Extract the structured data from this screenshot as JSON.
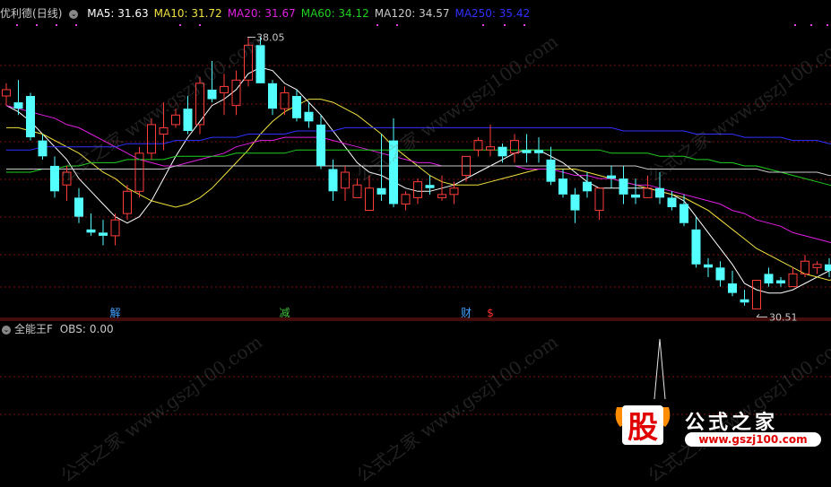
{
  "stock_name": "优利德",
  "period": "(日线)",
  "ma_legend": [
    {
      "label": "MA5",
      "value": "31.63",
      "color": "#ffffff"
    },
    {
      "label": "MA10",
      "value": "31.72",
      "color": "#f0e040"
    },
    {
      "label": "MA20",
      "value": "31.67",
      "color": "#e020e0"
    },
    {
      "label": "MA60",
      "value": "34.12",
      "color": "#20d020"
    },
    {
      "label": "MA120",
      "value": "34.57",
      "color": "#c8c8c8"
    },
    {
      "label": "MA250",
      "value": "35.42",
      "color": "#3030ff"
    }
  ],
  "indicator": {
    "name": "全能王F",
    "series_label": "OBS:",
    "series_value": "0.00"
  },
  "high_label": "38.05",
  "low_label": "30.51",
  "event_markers": [
    {
      "text": "解",
      "color": "#40a0ff"
    },
    {
      "text": "减",
      "color": "#40c040"
    },
    {
      "text": "财",
      "color": "#40a0ff"
    },
    {
      "text": "$",
      "color": "#ff3030"
    }
  ],
  "watermark": {
    "text": "公式之家",
    "url": "www.gszj100.com",
    "diag_text": "公式之家 www.gszj100.com",
    "logo_char": "股"
  },
  "colors": {
    "up": "#ff3c3c",
    "down": "#54ffff",
    "bg": "#000000",
    "grid": "#7a1010"
  },
  "chart_data": {
    "type": "candlestick",
    "title": "优利德 (日线)",
    "price_range": [
      29.2,
      38.6
    ],
    "candles": [
      [
        36.2,
        36.6,
        35.9,
        36.4
      ],
      [
        36.0,
        36.7,
        35.6,
        35.8
      ],
      [
        36.2,
        36.3,
        34.8,
        34.9
      ],
      [
        34.8,
        35.0,
        34.2,
        34.3
      ],
      [
        34.0,
        34.3,
        33.0,
        33.2
      ],
      [
        33.4,
        34.0,
        32.9,
        33.8
      ],
      [
        33.0,
        33.3,
        32.2,
        32.4
      ],
      [
        32.0,
        32.5,
        31.8,
        31.9
      ],
      [
        31.9,
        32.3,
        31.5,
        31.8
      ],
      [
        31.8,
        32.5,
        31.5,
        32.3
      ],
      [
        32.5,
        33.4,
        32.3,
        33.2
      ],
      [
        33.2,
        34.6,
        33.0,
        34.4
      ],
      [
        34.4,
        35.5,
        34.2,
        35.3
      ],
      [
        35.0,
        36.0,
        34.5,
        35.2
      ],
      [
        35.3,
        35.8,
        35.2,
        35.6
      ],
      [
        35.8,
        36.2,
        35.0,
        35.1
      ],
      [
        35.3,
        36.8,
        35.0,
        36.6
      ],
      [
        36.4,
        37.3,
        36.0,
        36.1
      ],
      [
        36.3,
        36.9,
        35.6,
        36.5
      ],
      [
        35.9,
        37.0,
        35.6,
        36.7
      ],
      [
        36.7,
        38.05,
        36.5,
        37.8
      ],
      [
        37.8,
        38.05,
        36.6,
        36.6
      ],
      [
        36.6,
        36.7,
        35.6,
        35.8
      ],
      [
        35.8,
        36.5,
        35.6,
        36.3
      ],
      [
        36.2,
        36.4,
        35.4,
        35.5
      ],
      [
        35.7,
        36.0,
        35.2,
        35.4
      ],
      [
        35.3,
        35.6,
        33.9,
        34.0
      ],
      [
        33.9,
        34.2,
        32.9,
        33.2
      ],
      [
        33.3,
        34.0,
        32.9,
        33.8
      ],
      [
        33.0,
        33.6,
        33.0,
        33.4
      ],
      [
        32.6,
        33.7,
        32.6,
        33.3
      ],
      [
        33.3,
        35.0,
        32.9,
        33.1
      ],
      [
        34.8,
        35.5,
        32.7,
        32.8
      ],
      [
        32.8,
        33.2,
        32.6,
        33.1
      ],
      [
        33.0,
        33.6,
        32.8,
        33.5
      ],
      [
        33.4,
        33.7,
        33.1,
        33.3
      ],
      [
        33.0,
        33.7,
        32.9,
        33.1
      ],
      [
        33.1,
        33.5,
        32.8,
        33.3
      ],
      [
        33.7,
        34.3,
        33.5,
        34.3
      ],
      [
        34.5,
        34.9,
        34.3,
        34.8
      ],
      [
        34.5,
        35.3,
        34.3,
        34.6
      ],
      [
        34.6,
        34.7,
        34.1,
        34.3
      ],
      [
        34.4,
        35.0,
        34.1,
        34.8
      ],
      [
        34.5,
        35.0,
        34.1,
        34.4
      ],
      [
        34.5,
        34.9,
        34.1,
        34.4
      ],
      [
        34.2,
        34.6,
        33.4,
        33.5
      ],
      [
        33.6,
        33.9,
        33.0,
        33.1
      ],
      [
        33.1,
        33.3,
        32.2,
        32.6
      ],
      [
        33.5,
        33.8,
        33.0,
        33.2
      ],
      [
        32.6,
        33.3,
        32.3,
        33.3
      ],
      [
        33.7,
        34.0,
        33.3,
        33.6
      ],
      [
        33.6,
        34.0,
        32.8,
        33.1
      ],
      [
        33.1,
        33.6,
        32.8,
        33.0
      ],
      [
        33.0,
        33.7,
        33.0,
        33.3
      ],
      [
        33.3,
        33.8,
        32.8,
        33.0
      ],
      [
        33.0,
        33.2,
        32.6,
        32.7
      ],
      [
        32.8,
        33.1,
        32.1,
        32.2
      ],
      [
        32.0,
        32.4,
        30.8,
        30.9
      ],
      [
        30.9,
        31.1,
        30.5,
        30.8
      ],
      [
        30.8,
        31.0,
        30.2,
        30.4
      ],
      [
        30.3,
        30.7,
        29.9,
        30.0
      ],
      [
        29.8,
        30.1,
        29.6,
        29.7
      ],
      [
        29.5,
        30.4,
        29.5,
        30.4
      ],
      [
        30.6,
        30.8,
        30.2,
        30.3
      ],
      [
        30.4,
        30.5,
        30.2,
        30.3
      ],
      [
        30.2,
        30.8,
        30.2,
        30.6
      ],
      [
        30.6,
        31.2,
        30.5,
        31.0
      ],
      [
        30.8,
        31.0,
        30.6,
        30.9
      ],
      [
        30.9,
        31.1,
        30.5,
        30.7
      ],
      [
        30.7,
        31.0,
        30.3,
        30.5
      ]
    ],
    "ma_series": {
      "MA5": [
        35.9,
        35.7,
        35.4,
        35.0,
        34.6,
        34.2,
        33.6,
        33.2,
        32.8,
        32.4,
        32.2,
        32.4,
        32.9,
        33.6,
        34.3,
        34.9,
        35.4,
        35.9,
        36.1,
        36.4,
        36.9,
        37.1,
        37.0,
        36.6,
        36.4,
        36.0,
        35.6,
        35.1,
        34.6,
        34.1,
        33.8,
        33.7,
        33.5,
        33.3,
        33.2,
        33.2,
        33.3,
        33.4,
        33.6,
        33.8,
        34.0,
        34.2,
        34.4,
        34.5,
        34.5,
        34.3,
        34.1,
        33.8,
        33.5,
        33.3,
        33.3,
        33.3,
        33.3,
        33.3,
        33.2,
        33.1,
        32.9,
        32.4,
        31.9,
        31.4,
        30.9,
        30.3,
        30.1,
        30.0,
        30.0,
        30.1,
        30.3,
        30.5,
        30.7,
        30.8
      ],
      "MA10": [
        35.2,
        35.2,
        35.1,
        35.0,
        34.8,
        34.6,
        34.4,
        34.1,
        33.8,
        33.6,
        33.3,
        33.1,
        32.9,
        32.8,
        32.7,
        32.8,
        33.0,
        33.3,
        33.7,
        34.1,
        34.5,
        35.0,
        35.4,
        35.7,
        35.9,
        36.1,
        36.1,
        36.0,
        35.8,
        35.6,
        35.3,
        35.0,
        34.6,
        34.3,
        34.0,
        33.7,
        33.5,
        33.4,
        33.4,
        33.4,
        33.5,
        33.6,
        33.7,
        33.8,
        33.9,
        33.9,
        33.9,
        33.9,
        33.8,
        33.7,
        33.6,
        33.5,
        33.4,
        33.3,
        33.2,
        33.1,
        33.0,
        32.8,
        32.6,
        32.3,
        32.0,
        31.7,
        31.4,
        31.2,
        31.0,
        30.8,
        30.6,
        30.5,
        30.4,
        30.5
      ],
      "MA20": [
        35.9,
        35.8,
        35.7,
        35.6,
        35.5,
        35.3,
        35.2,
        35.0,
        34.8,
        34.6,
        34.4,
        34.2,
        34.1,
        34.0,
        34.0,
        34.1,
        34.2,
        34.3,
        34.4,
        34.6,
        34.7,
        34.8,
        34.8,
        34.9,
        34.9,
        34.9,
        34.9,
        34.8,
        34.7,
        34.6,
        34.5,
        34.4,
        34.3,
        34.2,
        34.1,
        34.1,
        34.0,
        34.0,
        34.0,
        34.0,
        34.0,
        34.0,
        34.0,
        33.9,
        33.9,
        33.9,
        33.8,
        33.7,
        33.7,
        33.6,
        33.6,
        33.5,
        33.4,
        33.4,
        33.3,
        33.2,
        33.1,
        33.0,
        32.9,
        32.8,
        32.6,
        32.5,
        32.3,
        32.2,
        32.1,
        31.9,
        31.8,
        31.7,
        31.6,
        31.5
      ],
      "MA60": [
        33.8,
        33.8,
        33.8,
        33.9,
        33.9,
        34.0,
        34.0,
        34.1,
        34.1,
        34.1,
        34.2,
        34.2,
        34.2,
        34.2,
        34.3,
        34.3,
        34.3,
        34.3,
        34.3,
        34.4,
        34.4,
        34.4,
        34.4,
        34.4,
        34.5,
        34.5,
        34.5,
        34.5,
        34.5,
        34.5,
        34.5,
        34.5,
        34.5,
        34.5,
        34.5,
        34.5,
        34.5,
        34.5,
        34.5,
        34.5,
        34.5,
        34.5,
        34.5,
        34.5,
        34.5,
        34.5,
        34.5,
        34.5,
        34.5,
        34.5,
        34.4,
        34.4,
        34.4,
        34.4,
        34.3,
        34.3,
        34.3,
        34.2,
        34.2,
        34.1,
        34.1,
        34.0,
        34.0,
        33.9,
        33.8,
        33.7,
        33.6,
        33.5,
        33.4,
        33.3
      ],
      "MA120": [
        33.9,
        33.9,
        33.9,
        33.9,
        33.9,
        33.9,
        33.9,
        33.9,
        33.9,
        33.9,
        33.9,
        33.9,
        33.9,
        33.9,
        34.0,
        34.0,
        34.0,
        34.0,
        34.0,
        34.0,
        34.0,
        34.0,
        34.0,
        34.0,
        34.0,
        34.0,
        34.0,
        34.0,
        34.0,
        34.0,
        34.0,
        34.0,
        34.0,
        34.0,
        34.0,
        34.0,
        34.0,
        34.0,
        34.0,
        34.0,
        34.0,
        34.0,
        34.0,
        34.0,
        34.0,
        34.0,
        34.0,
        34.0,
        34.0,
        34.0,
        34.0,
        34.0,
        34.0,
        33.9,
        33.9,
        33.9,
        33.9,
        33.9,
        33.9,
        33.9,
        33.9,
        33.9,
        33.9,
        33.8,
        33.8,
        33.8,
        33.8,
        33.8,
        33.7,
        33.7
      ],
      "MA250": [
        34.5,
        34.5,
        34.5,
        34.6,
        34.6,
        34.6,
        34.6,
        34.6,
        34.6,
        34.6,
        34.7,
        34.7,
        34.7,
        34.7,
        34.8,
        34.8,
        34.8,
        34.9,
        34.9,
        34.9,
        35.0,
        35.0,
        35.0,
        35.0,
        35.1,
        35.1,
        35.1,
        35.1,
        35.2,
        35.2,
        35.2,
        35.2,
        35.2,
        35.2,
        35.2,
        35.2,
        35.2,
        35.2,
        35.2,
        35.2,
        35.2,
        35.2,
        35.2,
        35.2,
        35.2,
        35.2,
        35.2,
        35.2,
        35.2,
        35.2,
        35.2,
        35.1,
        35.1,
        35.1,
        35.1,
        35.1,
        35.1,
        35.0,
        35.0,
        35.0,
        35.0,
        34.9,
        34.9,
        34.9,
        34.9,
        34.8,
        34.8,
        34.8,
        34.7,
        34.7
      ]
    },
    "event_marker_indices": [
      9,
      23,
      38,
      40
    ],
    "high_marker_index": 20,
    "low_marker_index": 62,
    "indicator_spike_index": 54,
    "indicator_range": [
      0,
      1
    ]
  }
}
